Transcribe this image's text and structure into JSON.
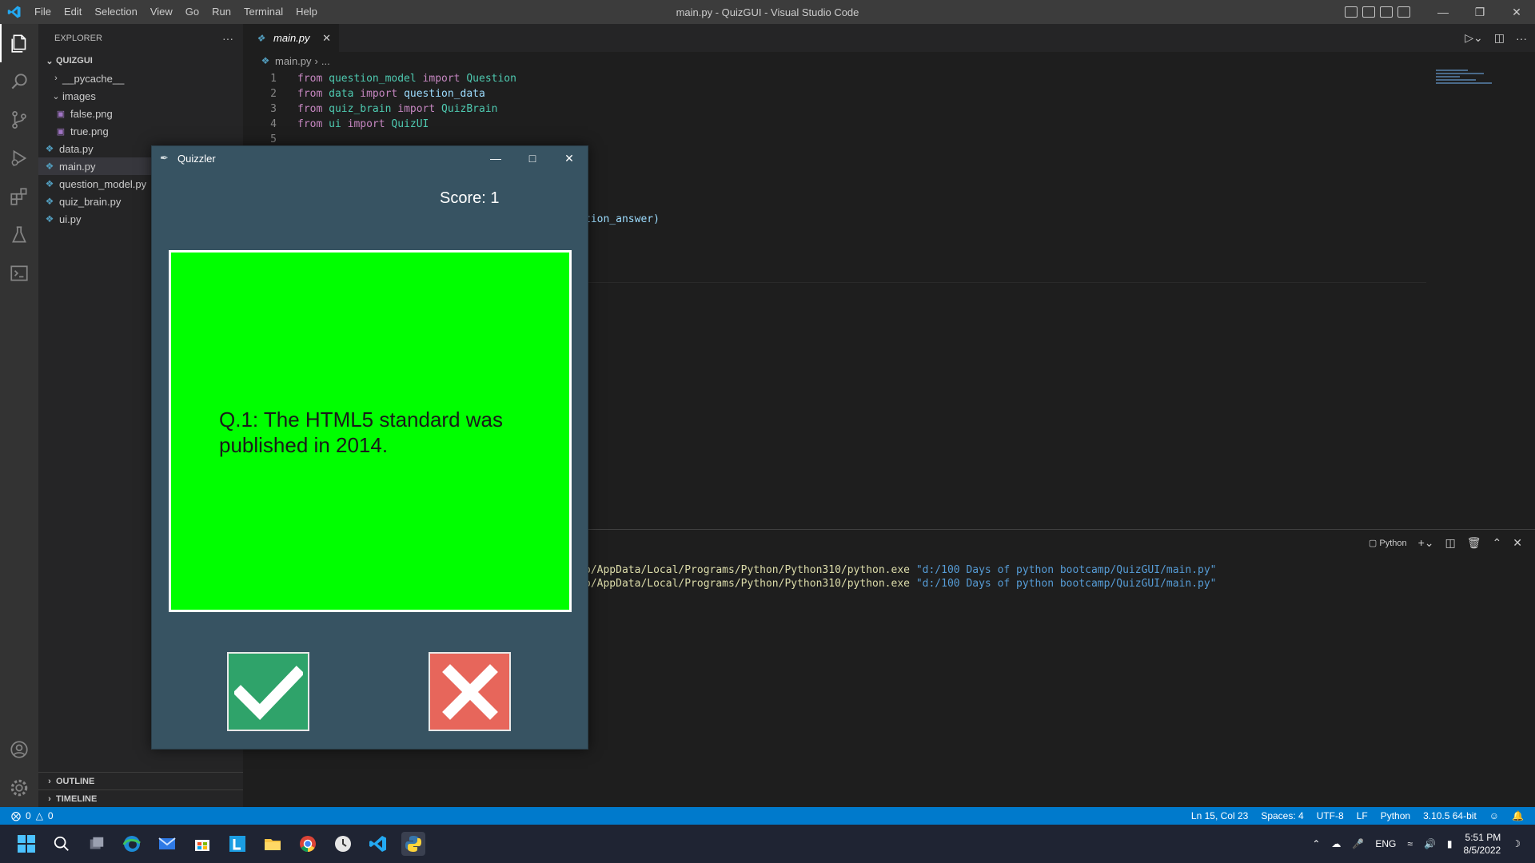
{
  "window": {
    "title": "main.py - QuizGUI - Visual Studio Code",
    "menu": [
      "File",
      "Edit",
      "Selection",
      "View",
      "Go",
      "Run",
      "Terminal",
      "Help"
    ]
  },
  "explorer": {
    "header": "EXPLORER",
    "more": "···",
    "project": "QUIZGUI",
    "items": [
      {
        "label": "__pycache__",
        "kind": "folder-collapsed"
      },
      {
        "label": "images",
        "kind": "folder-open"
      },
      {
        "label": "false.png",
        "kind": "image"
      },
      {
        "label": "true.png",
        "kind": "image"
      },
      {
        "label": "data.py",
        "kind": "python"
      },
      {
        "label": "main.py",
        "kind": "python"
      },
      {
        "label": "question_model.py",
        "kind": "python"
      },
      {
        "label": "quiz_brain.py",
        "kind": "python"
      },
      {
        "label": "ui.py",
        "kind": "python"
      }
    ],
    "outline": "OUTLINE",
    "timeline": "TIMELINE"
  },
  "editor": {
    "tab": "main.py",
    "breadcrumb": [
      "main.py",
      "..."
    ],
    "lines": [
      {
        "n": "1",
        "tokens": [
          {
            "t": "from",
            "c": "kw"
          },
          {
            "t": " ",
            "c": ""
          },
          {
            "t": "question_model",
            "c": "mod"
          },
          {
            "t": " ",
            "c": ""
          },
          {
            "t": "import",
            "c": "kw"
          },
          {
            "t": " ",
            "c": ""
          },
          {
            "t": "Question",
            "c": "mod"
          }
        ]
      },
      {
        "n": "2",
        "tokens": [
          {
            "t": "from",
            "c": "kw"
          },
          {
            "t": " ",
            "c": ""
          },
          {
            "t": "data",
            "c": "mod"
          },
          {
            "t": " ",
            "c": ""
          },
          {
            "t": "import",
            "c": "kw"
          },
          {
            "t": " ",
            "c": ""
          },
          {
            "t": "question_data",
            "c": "var"
          }
        ]
      },
      {
        "n": "3",
        "tokens": [
          {
            "t": "from",
            "c": "kw"
          },
          {
            "t": " ",
            "c": ""
          },
          {
            "t": "quiz_brain",
            "c": "mod"
          },
          {
            "t": " ",
            "c": ""
          },
          {
            "t": "import",
            "c": "kw"
          },
          {
            "t": " ",
            "c": ""
          },
          {
            "t": "QuizBrain",
            "c": "mod"
          }
        ]
      },
      {
        "n": "4",
        "tokens": [
          {
            "t": "from",
            "c": "kw"
          },
          {
            "t": " ",
            "c": ""
          },
          {
            "t": "ui",
            "c": "mod"
          },
          {
            "t": " ",
            "c": ""
          },
          {
            "t": "import",
            "c": "kw"
          },
          {
            "t": " ",
            "c": ""
          },
          {
            "t": "QuizUI",
            "c": "mod"
          }
        ]
      },
      {
        "n": "5",
        "tokens": []
      }
    ],
    "partial_code": [
      "]",
      "tion_answer)"
    ]
  },
  "terminal": {
    "shell": "Python",
    "lines": [
      {
        "path": "o/AppData/Local/Programs/Python/Python310/python.exe",
        "arg": "\"d:/100 Days of python bootcamp/QuizGUI/main.py\""
      },
      {
        "path": "o/AppData/Local/Programs/Python/Python310/python.exe",
        "arg": "\"d:/100 Days of python bootcamp/QuizGUI/main.py\""
      }
    ]
  },
  "statusbar": {
    "errors": "0",
    "warnings": "0",
    "position": "Ln 15, Col 23",
    "spaces": "Spaces: 4",
    "encoding": "UTF-8",
    "eol": "LF",
    "language": "Python",
    "interpreter": "3.10.5 64-bit"
  },
  "taskbar": {
    "lang": "ENG",
    "time": "5:51 PM",
    "date": "8/5/2022"
  },
  "quizzler": {
    "title": "Quizzler",
    "score": "Score: 1",
    "question": "Q.1: The HTML5 standard was published in 2014.",
    "card_color": "#00ff00",
    "bg_color": "#375362",
    "true_icon": "check-icon",
    "false_icon": "cross-icon"
  }
}
